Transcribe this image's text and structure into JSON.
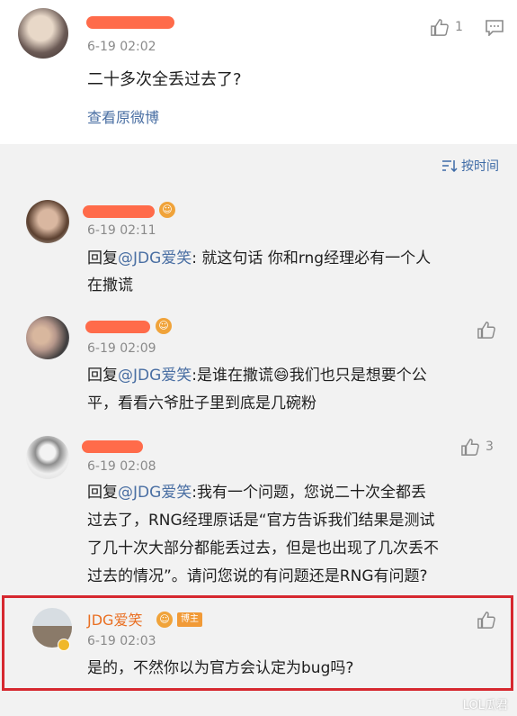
{
  "top_post": {
    "time": "6-19 02:02",
    "text": "二十多次全丢过去了?",
    "link": "查看原微博",
    "likes": "1"
  },
  "sort_label": "按时间",
  "comments": [
    {
      "time": "6-19 02:11",
      "reply_prefix": "回复",
      "mention": "@JDG爱笑",
      "line1": ": 就这句话 你和rng经理必有一个人",
      "line2": "在撒谎"
    },
    {
      "time": "6-19 02:09",
      "reply_prefix": "回复",
      "mention": "@JDG爱笑",
      "line1": ":是谁在撒谎😄我们也只是想要个公",
      "line2": "平，看看六爷肚子里到底是几碗粉"
    },
    {
      "time": "6-19 02:08",
      "reply_prefix": "回复",
      "mention": "@JDG爱笑",
      "line1": ":我有一个问题，您说二十次全都丢",
      "line2": "过去了，RNG经理原话是“官方告诉我们结果是测试",
      "line3": "了几十次大部分都能丢过去，但是也出现了几次丢不",
      "line4": "过去的情况”。请问您说的有问题还是RNG有问题?",
      "likes": "3"
    },
    {
      "author": "JDG爱笑",
      "badge": "博主",
      "time": "6-19 02:03",
      "text": "是的，不然你以为官方会认定为bug吗?"
    }
  ],
  "watermark": "LOL瓜君",
  "colors": {
    "accent": "#4a6fa3",
    "highlight": "#d6282f",
    "redaction": "#ff6b4a"
  }
}
